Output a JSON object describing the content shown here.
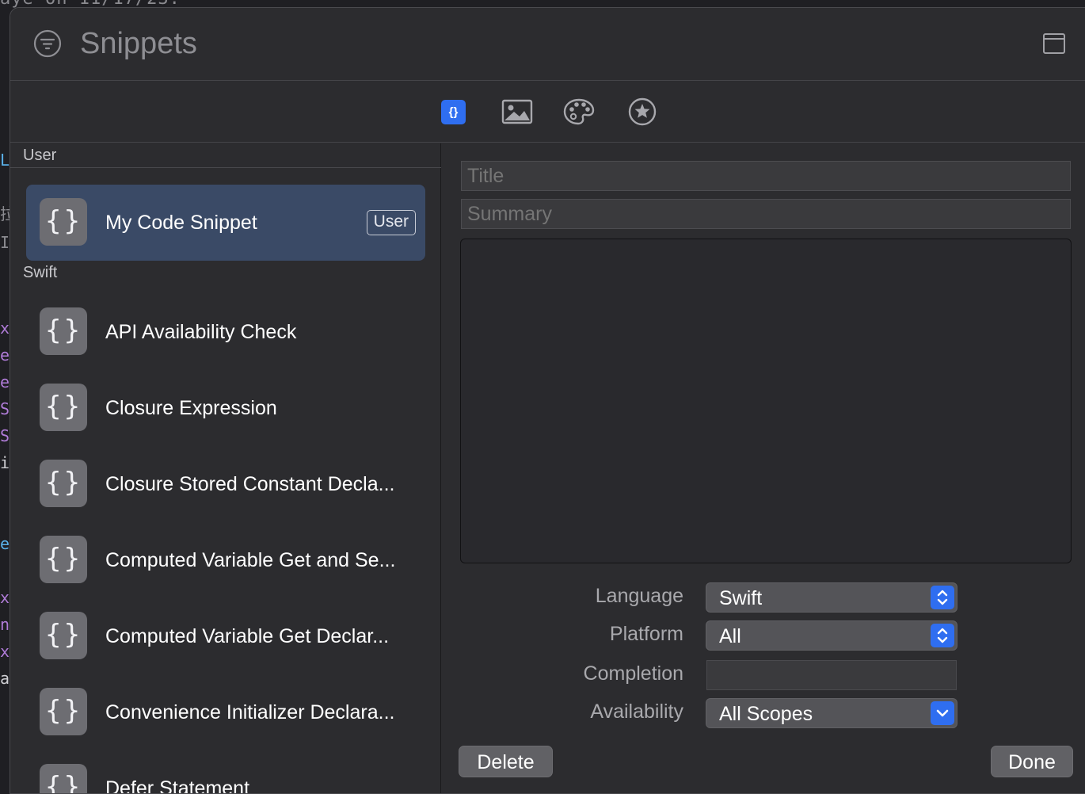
{
  "background": {
    "top_text": "aye on 11/17/23.",
    "colors": {
      "editor_bg": "#1f1f23",
      "purple": "#b07cd8",
      "blue": "#5ab0e8",
      "gray": "#8a8a8f"
    }
  },
  "header": {
    "title": "Snippets",
    "filter_icon": "filter-circle-icon",
    "window_icon": "window-layout-icon"
  },
  "toolbar": {
    "tabs": [
      {
        "name": "code-snippets",
        "icon": "curly-braces-icon",
        "glyph": "{}",
        "active": true
      },
      {
        "name": "media",
        "icon": "image-icon",
        "active": false
      },
      {
        "name": "colors",
        "icon": "palette-icon",
        "active": false
      },
      {
        "name": "symbols",
        "icon": "star-circle-icon",
        "active": false
      }
    ],
    "accent": "#2f6ef0"
  },
  "list": {
    "sections": [
      {
        "title": "User"
      },
      {
        "title": "Swift"
      }
    ],
    "items": [
      {
        "label": "My Code Snippet",
        "badge": "User",
        "selected": true,
        "icon_glyph": "{}"
      },
      {
        "label": "API Availability Check",
        "icon_glyph": "{}"
      },
      {
        "label": "Closure Expression",
        "icon_glyph": "{}"
      },
      {
        "label": "Closure Stored Constant Decla...",
        "icon_glyph": "{}"
      },
      {
        "label": "Computed Variable Get and Se...",
        "icon_glyph": "{}"
      },
      {
        "label": "Computed Variable Get Declar...",
        "icon_glyph": "{}"
      },
      {
        "label": "Convenience Initializer Declara...",
        "icon_glyph": "{}"
      },
      {
        "label": "Defer Statement",
        "icon_glyph": "{}"
      }
    ]
  },
  "editor": {
    "title_placeholder": "Title",
    "summary_placeholder": "Summary",
    "code": "",
    "properties": {
      "language": {
        "label": "Language",
        "value": "Swift"
      },
      "platform": {
        "label": "Platform",
        "value": "All"
      },
      "completion": {
        "label": "Completion",
        "value": ""
      },
      "availability": {
        "label": "Availability",
        "value": "All Scopes"
      }
    },
    "delete_label": "Delete",
    "done_label": "Done"
  }
}
